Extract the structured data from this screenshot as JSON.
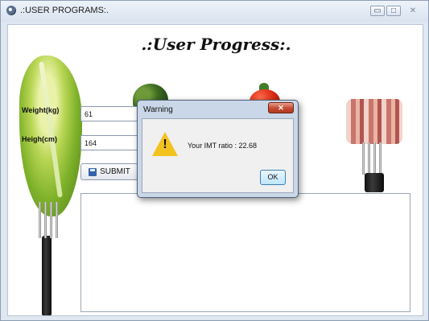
{
  "window": {
    "title": ".:USER PROGRAMS:.",
    "controls": {
      "minimize": "▭",
      "maximize": "□",
      "close": "✕"
    }
  },
  "main": {
    "heading": ".:User Progress:.",
    "weight_label": "Weight(kg)",
    "weight_value": "61",
    "height_label": "Heigh(cm)",
    "height_value": "164",
    "submit_label": "SUBMIT",
    "submit_icon": "save-icon"
  },
  "dialog": {
    "title": "Warning",
    "close_glyph": "✕",
    "icon": "warning-icon",
    "warning_glyph": "!",
    "message": "Your IMT ratio : 22.68",
    "ok_label": "OK"
  },
  "colors": {
    "titlebar": "#dfe7f1",
    "dialog_frame": "#c9d7e8",
    "close_button": "#c44a31",
    "warning": "#f4c21f"
  }
}
